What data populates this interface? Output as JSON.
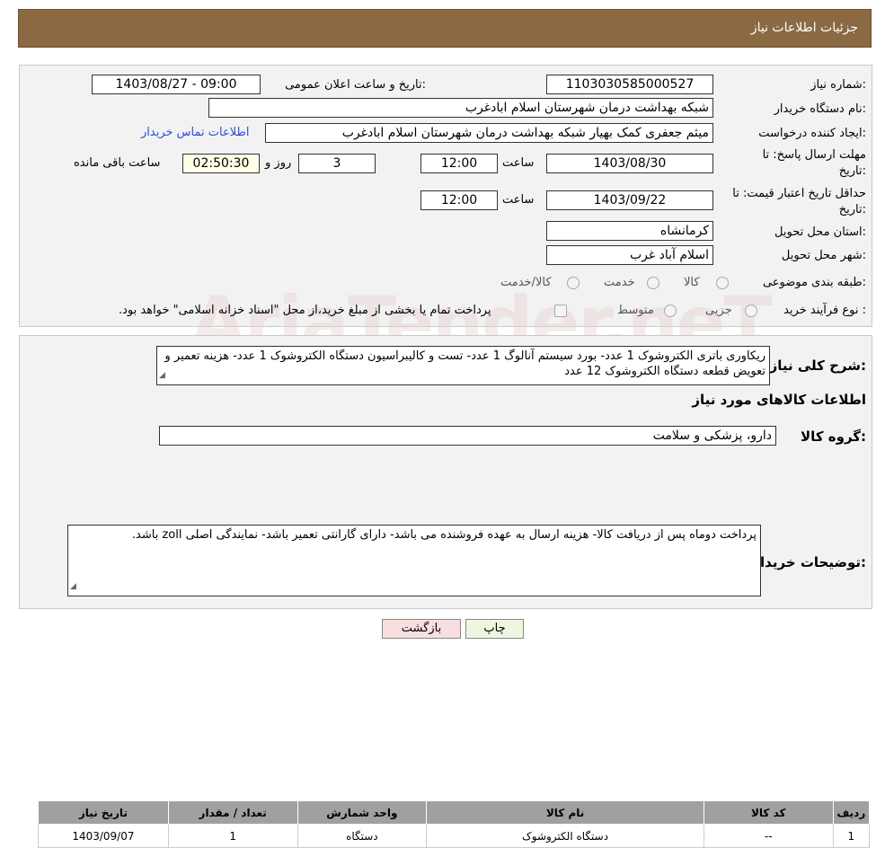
{
  "header": {
    "title": "جزئیات اطلاعات نیاز"
  },
  "form": {
    "need_number_label": "شماره نیاز:",
    "need_number": "1103030585000527",
    "announce_label": "تاریخ و ساعت اعلان عمومی:",
    "announce_value": "1403/08/27 - 09:00",
    "buyer_org_label": "نام دستگاه خریدار:",
    "buyer_org": "شبکه بهداشت درمان شهرستان اسلام ابادغرب",
    "creator_label": "ایجاد کننده درخواست:",
    "creator": "میثم جعفری کمک بهیار شبکه بهداشت درمان شهرستان اسلام ابادغرب",
    "contact_link": "اطلاعات تماس خریدار",
    "deadline_label_1": "مهلت ارسال پاسخ: تا",
    "deadline_label_2": "تاریخ:",
    "deadline_date": "1403/08/30",
    "time_label": "ساعت",
    "deadline_time": "12:00",
    "days_value": "3",
    "days_label": "روز و",
    "remaining_time": "02:50:30",
    "remaining_label": "ساعت باقی مانده",
    "validity_label_1": "حداقل تاریخ اعتبار قیمت: تا",
    "validity_label_2": "تاریخ:",
    "validity_date": "1403/09/22",
    "validity_time": "12:00",
    "province_label": "استان محل تحویل:",
    "province": "کرمانشاه",
    "city_label": "شهر محل تحویل:",
    "city": "اسلام آباد غرب",
    "category_label": "طبقه بندی موضوعی:",
    "category_options": [
      "کالا",
      "خدمت",
      "کالا/خدمت"
    ],
    "process_label": "نوع فرآیند خرید :",
    "process_options": [
      "جزیی",
      "متوسط"
    ],
    "process_note": "پرداخت تمام یا بخشی از مبلغ خرید،از محل \"اسناد خزانه اسلامی\" خواهد بود."
  },
  "details": {
    "desc_label": "شرح کلی نیاز:",
    "desc_text": "ریکاوری باتری الکتروشوک 1 عدد- بورد سیستم آنالوگ 1 عدد- تست و کالیبراسیون دستگاه الکتروشوک 1 عدد- هزینه تعمیر و تعویض قطعه دستگاه الکتروشوک  12 عدد",
    "goods_info_title": "اطلاعات کالاهای مورد نیاز",
    "group_label": "گروه کالا:",
    "group_value": "دارو، پزشکی و سلامت",
    "table": {
      "headers": [
        "ردیف",
        "کد کالا",
        "نام کالا",
        "واحد شمارش",
        "تعداد / مقدار",
        "تاریخ نیاز"
      ],
      "rows": [
        [
          "1",
          "--",
          "دستگاه الکتروشوک",
          "دستگاه",
          "1",
          "1403/09/07"
        ]
      ]
    },
    "buyer_notes_label": "توضیحات خریدار:",
    "buyer_notes": "پرداخت دوماه پس از دریافت کالا- هزینه ارسال  به عهده فروشنده می باشد- دارای گارانتی تعمیر باشد- نمایندگی اصلی zoll باشد."
  },
  "buttons": {
    "print": "چاپ",
    "back": "بازگشت"
  },
  "watermark": "AriaTender.neT",
  "colors": {
    "header": "#8b6a43",
    "link": "#2a4fd6",
    "back_button": "#f8dede",
    "print_button": "#eef6e0"
  }
}
